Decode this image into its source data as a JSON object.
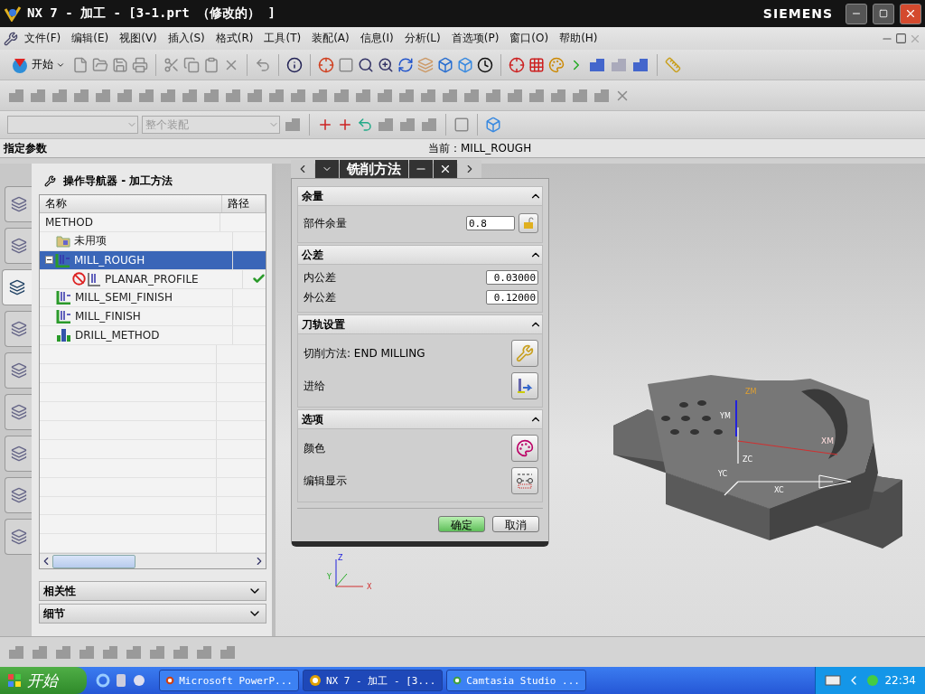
{
  "window": {
    "title": "NX 7 - 加工 - [3-1.prt （修改的） ]",
    "brand": "SIEMENS"
  },
  "menu": [
    "文件(F)",
    "编辑(E)",
    "视图(V)",
    "插入(S)",
    "格式(R)",
    "工具(T)",
    "装配(A)",
    "信息(I)",
    "分析(L)",
    "首选项(P)",
    "窗口(O)",
    "帮助(H)"
  ],
  "start_button": "开始",
  "selection_bar": {
    "filter_value": "整个装配"
  },
  "cue_line": {
    "prompt": "指定参数",
    "status": "当前：MILL_ROUGH"
  },
  "side_tabs": [
    {
      "selected": false
    },
    {
      "selected": false
    },
    {
      "selected": true
    },
    {
      "selected": false
    },
    {
      "selected": false
    },
    {
      "selected": false
    },
    {
      "selected": false
    },
    {
      "selected": false
    },
    {
      "selected": false
    }
  ],
  "navigator": {
    "title": "操作导航器 - 加工方法",
    "columns": [
      "名称",
      "路径"
    ],
    "rows": [
      {
        "name": "METHOD",
        "selected": false,
        "path_done": false,
        "children": [
          {
            "name": "未用项",
            "kind": "folder",
            "selected": false,
            "path_done": false
          },
          {
            "name": "MILL_ROUGH",
            "kind": "method",
            "selected": true,
            "path_done": false,
            "expanded": true,
            "children": [
              {
                "name": "PLANAR_PROFILE",
                "kind": "operation",
                "selected": false,
                "path_done": true
              }
            ]
          },
          {
            "name": "MILL_SEMI_FINISH",
            "kind": "method",
            "selected": false,
            "path_done": false
          },
          {
            "name": "MILL_FINISH",
            "kind": "method",
            "selected": false,
            "path_done": false
          },
          {
            "name": "DRILL_METHOD",
            "kind": "drill",
            "selected": false,
            "path_done": false
          }
        ]
      }
    ],
    "panels": [
      {
        "title": "相关性",
        "expanded": false
      },
      {
        "title": "细节",
        "expanded": false
      }
    ]
  },
  "dialog": {
    "title": "铣削方法",
    "sections": [
      {
        "title": "余量",
        "expanded": true,
        "rows": [
          {
            "kind": "field",
            "label": "部件余量",
            "value": "0.8",
            "lock": true
          }
        ]
      },
      {
        "title": "公差",
        "expanded": true,
        "rows": [
          {
            "kind": "field",
            "label": "内公差",
            "value": "0.03000"
          },
          {
            "kind": "field",
            "label": "外公差",
            "value": "0.12000"
          }
        ]
      },
      {
        "title": "刀轨设置",
        "expanded": true,
        "rows": [
          {
            "kind": "action",
            "label": "切削方法: END MILLING"
          },
          {
            "kind": "action",
            "label": "进给"
          }
        ]
      },
      {
        "title": "选项",
        "expanded": true,
        "rows": [
          {
            "kind": "action",
            "label": "颜色"
          },
          {
            "kind": "action",
            "label": "编辑显示"
          }
        ]
      }
    ],
    "buttons": [
      {
        "label": "确定",
        "default": true
      },
      {
        "label": "取消",
        "default": false
      }
    ]
  },
  "viewport": {
    "model_axes": [
      "ZM",
      "YM",
      "XM",
      "ZC",
      "YC",
      "XC"
    ],
    "triad": [
      "Z",
      "Y",
      "X"
    ]
  },
  "taskbar": {
    "start": "开始",
    "tasks": [
      {
        "label": "Microsoft PowerP...",
        "selected": false,
        "kind": "ppt"
      },
      {
        "label": "NX 7 - 加工 - [3...",
        "selected": true,
        "kind": "nx"
      },
      {
        "label": "Camtasia Studio ...",
        "selected": false,
        "kind": "cam"
      }
    ],
    "clock": "22:34"
  }
}
